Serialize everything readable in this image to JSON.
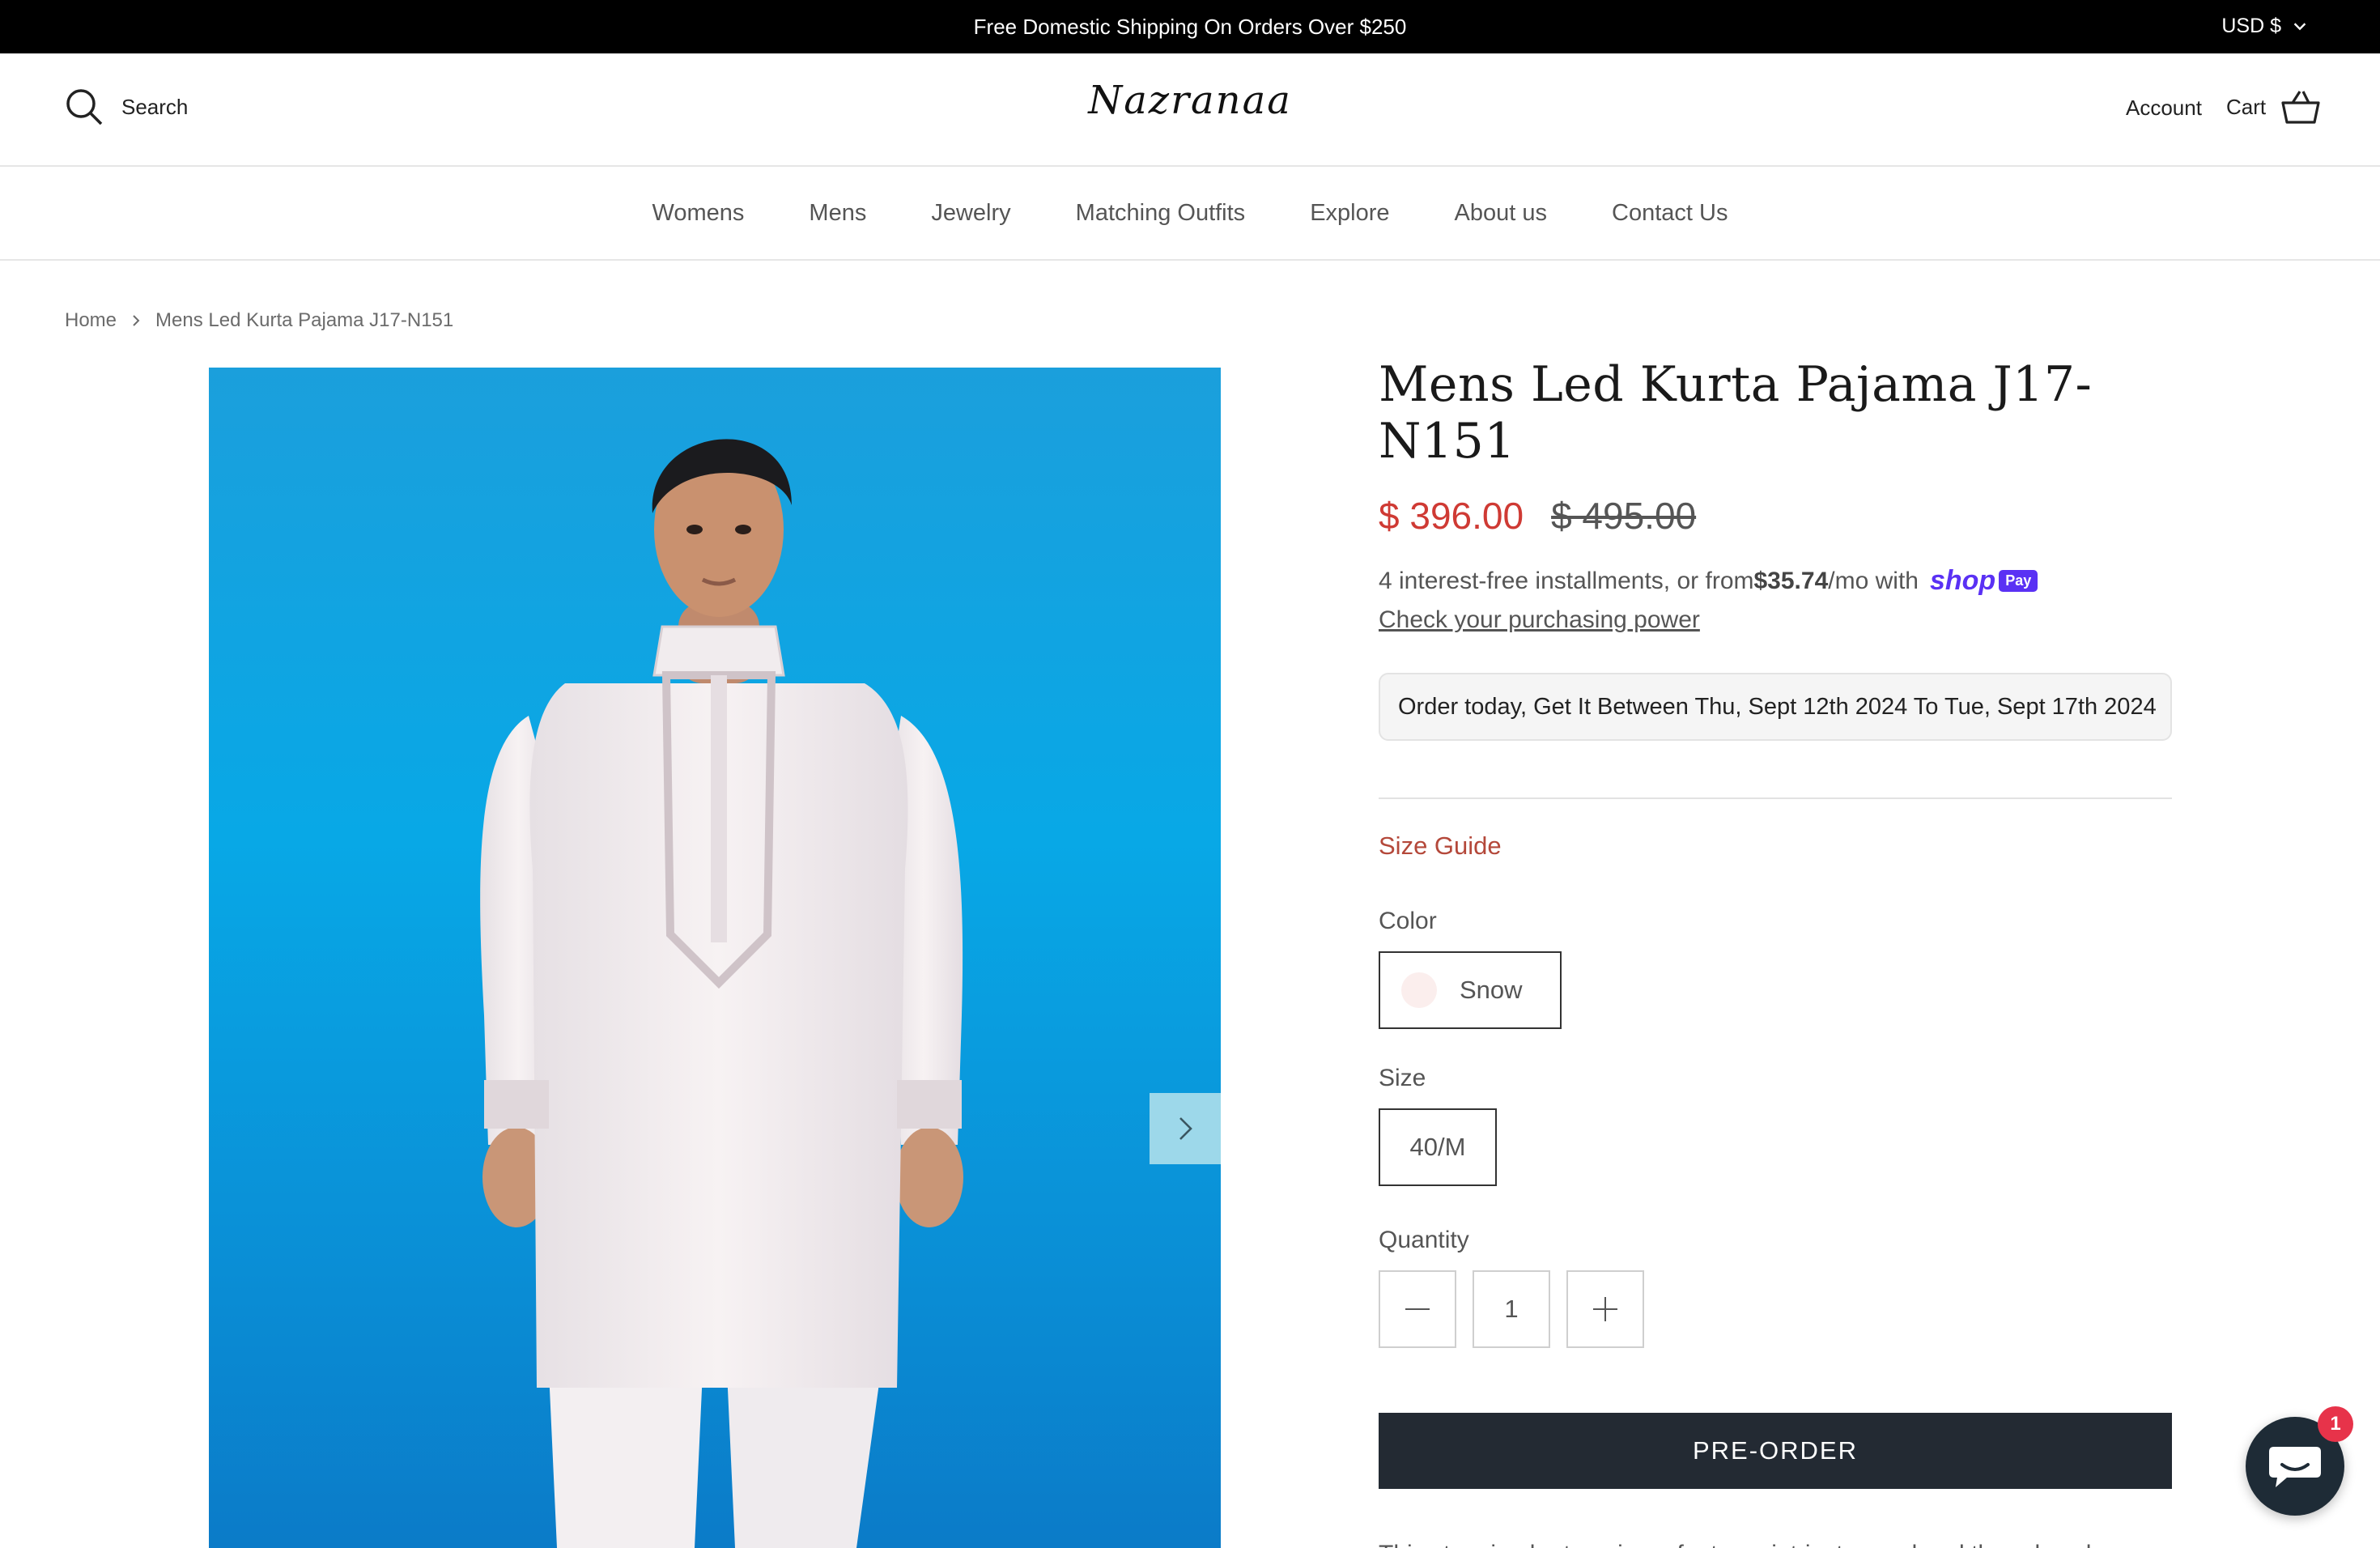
{
  "announcement": {
    "text": "Free Domestic Shipping On Orders Over $250",
    "currency": "USD $"
  },
  "header": {
    "search_label": "Search",
    "logo_text": "Nazranaa",
    "account_label": "Account",
    "cart_label": "Cart"
  },
  "nav": {
    "items": [
      "Womens",
      "Mens",
      "Jewelry",
      "Matching Outfits",
      "Explore",
      "About us",
      "Contact Us"
    ]
  },
  "breadcrumb": {
    "home": "Home",
    "current": "Mens Led Kurta Pajama J17-N151"
  },
  "product": {
    "title": "Mens Led Kurta Pajama J17-N151",
    "sale_price": "$ 396.00",
    "original_price": "$ 495.00",
    "installments_prefix": "4 interest-free installments, or from ",
    "installments_amount": "$35.74",
    "installments_suffix": "/mo with",
    "shop_logo": "shop",
    "pay_badge": "Pay",
    "check_power": "Check your purchasing power",
    "delivery": "Order today, Get It Between Thu, Sept 12th 2024 To Tue, Sept 17th 2024",
    "size_guide": "Size Guide",
    "color_label": "Color",
    "color_value": "Snow",
    "size_label": "Size",
    "size_value": "40/M",
    "quantity_label": "Quantity",
    "quantity_value": "1",
    "preorder_label": "PRE-ORDER",
    "description": "This stunning kurta pajama features intricate pearl and thread work,"
  },
  "chat": {
    "badge_count": "1"
  },
  "colors": {
    "sale": "#cf3a34",
    "size_guide": "#b4483a",
    "button": "#232a33",
    "shop_pay": "#5a31f4",
    "chat_badge": "#e7334a"
  }
}
